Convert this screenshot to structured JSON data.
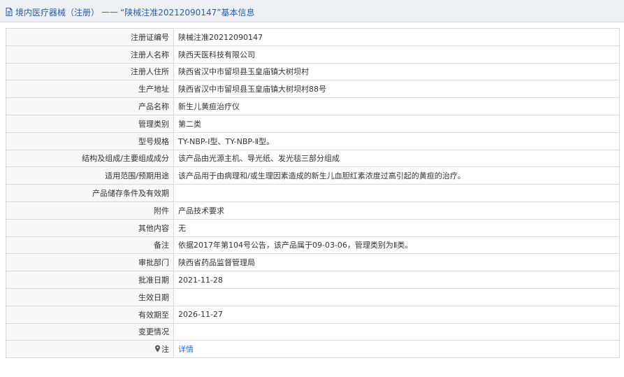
{
  "header": {
    "icon": "document-icon",
    "category": "境内医疗器械（注册）",
    "separator": "——",
    "registration_title": "“陕械注准20212090147”",
    "suffix": "基本信息",
    "colors": {
      "header_bg": "#eef0f3",
      "title_text": "#2d5b9e",
      "link": "#2d6ec9"
    }
  },
  "rows": [
    {
      "label": "注册证编号",
      "value": "陕械注准20212090147"
    },
    {
      "label": "注册人名称",
      "value": "陕西天医科技有限公司"
    },
    {
      "label": "注册人住所",
      "value": "陕西省汉中市留坝县玉皇庙镇大树坝村"
    },
    {
      "label": "生产地址",
      "value": "陕西省汉中市留坝县玉皇庙镇大树坝村88号"
    },
    {
      "label": "产品名称",
      "value": "新生儿黄疸治疗仪"
    },
    {
      "label": "管理类别",
      "value": "第二类"
    },
    {
      "label": "型号规格",
      "value": "TY-NBP-Ⅰ型、TY-NBP-Ⅱ型。"
    },
    {
      "label": "结构及组成/主要组成成分",
      "value": "该产品由光源主机、导光纸、发光毯三部分组成"
    },
    {
      "label": "适用范围/预期用途",
      "value": "该产品用于由病理和/或生理因素造成的新生儿血胆红素浓度过高引起的黄疸的治疗。"
    },
    {
      "label": "产品储存条件及有效期",
      "value": ""
    },
    {
      "label": "附件",
      "value": "产品技术要求"
    },
    {
      "label": "其他内容",
      "value": "无"
    },
    {
      "label": "备注",
      "value": "依据2017年第104号公告，该产品属于09-03-06，管理类别为Ⅱ类。"
    },
    {
      "label": "审批部门",
      "value": "陕西省药品监督管理局"
    },
    {
      "label": "批准日期",
      "value": "2021-11-28"
    },
    {
      "label": "生效日期",
      "value": ""
    },
    {
      "label": "有效期至",
      "value": "2026-11-27"
    },
    {
      "label": "变更情况",
      "value": ""
    }
  ],
  "note_row": {
    "icon": "pin-icon",
    "label": "注",
    "link_text": "详情"
  }
}
